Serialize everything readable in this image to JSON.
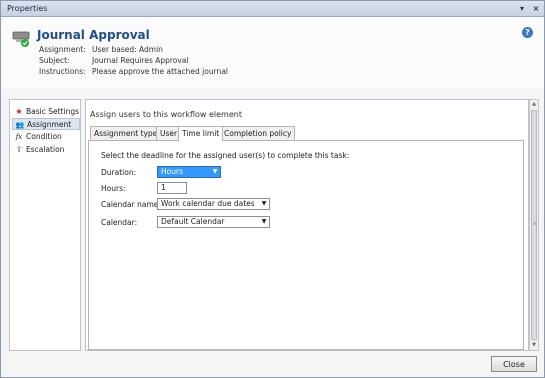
{
  "window": {
    "title": "Properties",
    "dropdown_glyph": "▾",
    "close_glyph": "×"
  },
  "header": {
    "title": "Journal Approval",
    "icon": "workflow-approval-icon",
    "help_icon": "help-icon",
    "help_glyph": "?",
    "rows": [
      {
        "label": "Assignment:",
        "value": "User based: Admin"
      },
      {
        "label": "Subject:",
        "value": "Journal Requires Approval"
      },
      {
        "label": "Instructions:",
        "value": "Please approve the attached journal"
      }
    ]
  },
  "sidebar": {
    "items": [
      {
        "label": "Basic Settings",
        "icon": "star-icon",
        "glyph": "★",
        "color": "#c0202a"
      },
      {
        "label": "Assignment",
        "icon": "users-icon",
        "glyph": "👥",
        "color": "#335577",
        "selected": true
      },
      {
        "label": "Condition",
        "icon": "function-icon",
        "glyph": "fx",
        "color": "#222222"
      },
      {
        "label": "Escalation",
        "icon": "escalation-icon",
        "glyph": "⇪",
        "color": "#a03030"
      }
    ]
  },
  "main": {
    "heading": "Assign users to this workflow element",
    "tabs": [
      {
        "label": "Assignment type"
      },
      {
        "label": "User"
      },
      {
        "label": "Time limit",
        "active": true
      },
      {
        "label": "Completion policy"
      }
    ],
    "time_limit": {
      "instruction": "Select the deadline for the assigned user(s)  to complete this task:",
      "duration": {
        "label": "Duration:",
        "value": "Hours"
      },
      "hours": {
        "label": "Hours:",
        "value": "1"
      },
      "calendar_name": {
        "label": "Calendar name:",
        "value": "Work calendar due dates"
      },
      "calendar": {
        "label": "Calendar:",
        "value": "Default Calendar"
      }
    }
  },
  "footer": {
    "close_label": "Close"
  },
  "colors": {
    "accent": "#1f4e8c",
    "selection": "#3399ff"
  }
}
